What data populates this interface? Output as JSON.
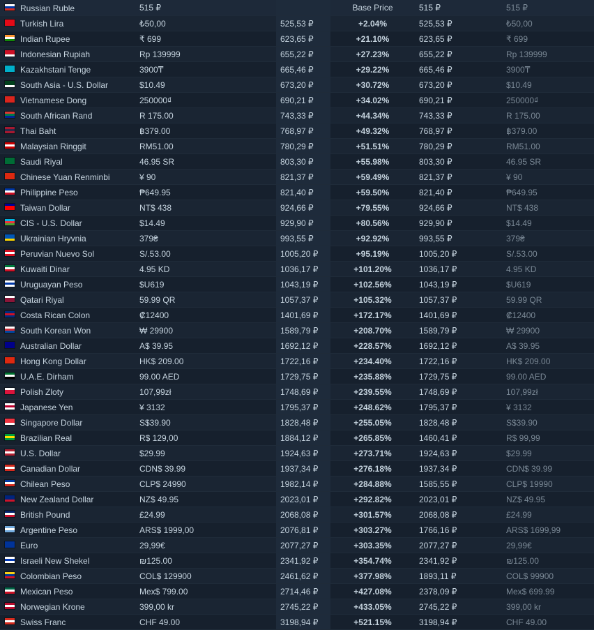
{
  "header": {
    "currency": "Russian Ruble",
    "local_price": "515 ₽",
    "base_price_label": "Base Price",
    "recommended": "515 ₽",
    "suggested": "515 ₽",
    "flag": [
      "#ffffff",
      "#0039a6",
      "#d52b1e"
    ]
  },
  "colors": {
    "increase": "#c94a4a",
    "decrease": "#9a8cf0",
    "text": "#c6d4df",
    "muted": "#7a8895"
  },
  "rows": [
    {
      "currency": "Turkish Lira",
      "local_price": "₺50,00",
      "base_price": "525,53 ₽",
      "diff": "+2.04%",
      "recommended": "525,53 ₽",
      "suggested": "₺50,00",
      "flag": [
        "#e30a17",
        "#e30a17",
        "#e30a17"
      ]
    },
    {
      "currency": "Indian Rupee",
      "local_price": "₹ 699",
      "base_price": "623,65 ₽",
      "diff": "+21.10%",
      "recommended": "623,65 ₽",
      "suggested": "₹ 699",
      "flag": [
        "#ff9933",
        "#ffffff",
        "#138808"
      ]
    },
    {
      "currency": "Indonesian Rupiah",
      "local_price": "Rp 139999",
      "base_price": "655,22 ₽",
      "diff": "+27.23%",
      "recommended": "655,22 ₽",
      "suggested": "Rp 139999",
      "flag": [
        "#ce1126",
        "#ce1126",
        "#ffffff"
      ]
    },
    {
      "currency": "Kazakhstani Tenge",
      "local_price": "3900₸",
      "base_price": "665,46 ₽",
      "diff": "+29.22%",
      "recommended": "665,46 ₽",
      "suggested": "3900₸",
      "flag": [
        "#00afca",
        "#00afca",
        "#00afca"
      ]
    },
    {
      "currency": "South Asia - U.S. Dollar",
      "local_price": "$10.49",
      "base_price": "673,20 ₽",
      "diff": "+30.72%",
      "recommended": "673,20 ₽",
      "suggested": "$10.49",
      "flag": [
        "#01411c",
        "#01411c",
        "#ffffff"
      ]
    },
    {
      "currency": "Vietnamese Dong",
      "local_price": "250000₫",
      "base_price": "690,21 ₽",
      "diff": "+34.02%",
      "recommended": "690,21 ₽",
      "suggested": "250000₫",
      "flag": [
        "#da251d",
        "#da251d",
        "#da251d"
      ]
    },
    {
      "currency": "South African Rand",
      "local_price": "R 175.00",
      "base_price": "743,33 ₽",
      "diff": "+44.34%",
      "recommended": "743,33 ₽",
      "suggested": "R 175.00",
      "flag": [
        "#de3831",
        "#007a4d",
        "#002395"
      ]
    },
    {
      "currency": "Thai Baht",
      "local_price": "฿379.00",
      "base_price": "768,97 ₽",
      "diff": "+49.32%",
      "recommended": "768,97 ₽",
      "suggested": "฿379.00",
      "flag": [
        "#a51931",
        "#2d2a4a",
        "#a51931"
      ]
    },
    {
      "currency": "Malaysian Ringgit",
      "local_price": "RM51.00",
      "base_price": "780,29 ₽",
      "diff": "+51.51%",
      "recommended": "780,29 ₽",
      "suggested": "RM51.00",
      "flag": [
        "#cc0001",
        "#ffffff",
        "#cc0001"
      ]
    },
    {
      "currency": "Saudi Riyal",
      "local_price": "46.95 SR",
      "base_price": "803,30 ₽",
      "diff": "+55.98%",
      "recommended": "803,30 ₽",
      "suggested": "46.95 SR",
      "flag": [
        "#006c35",
        "#006c35",
        "#006c35"
      ]
    },
    {
      "currency": "Chinese Yuan Renminbi",
      "local_price": "¥ 90",
      "base_price": "821,37 ₽",
      "diff": "+59.49%",
      "recommended": "821,37 ₽",
      "suggested": "¥ 90",
      "flag": [
        "#de2910",
        "#de2910",
        "#de2910"
      ]
    },
    {
      "currency": "Philippine Peso",
      "local_price": "₱649.95",
      "base_price": "821,40 ₽",
      "diff": "+59.50%",
      "recommended": "821,40 ₽",
      "suggested": "₱649.95",
      "flag": [
        "#0038a8",
        "#ffffff",
        "#ce1126"
      ]
    },
    {
      "currency": "Taiwan Dollar",
      "local_price": "NT$ 438",
      "base_price": "924,66 ₽",
      "diff": "+79.55%",
      "recommended": "924,66 ₽",
      "suggested": "NT$ 438",
      "flag": [
        "#000095",
        "#fe0000",
        "#fe0000"
      ]
    },
    {
      "currency": "CIS - U.S. Dollar",
      "local_price": "$14.49",
      "base_price": "929,90 ₽",
      "diff": "+80.56%",
      "recommended": "929,90 ₽",
      "suggested": "$14.49",
      "flag": [
        "#00b5e2",
        "#ef3340",
        "#509e2f"
      ]
    },
    {
      "currency": "Ukrainian Hryvnia",
      "local_price": "379₴",
      "base_price": "993,55 ₽",
      "diff": "+92.92%",
      "recommended": "993,55 ₽",
      "suggested": "379₴",
      "flag": [
        "#0057b7",
        "#0057b7",
        "#ffd700"
      ]
    },
    {
      "currency": "Peruvian Nuevo Sol",
      "local_price": "S/.53.00",
      "base_price": "1005,20 ₽",
      "diff": "+95.19%",
      "recommended": "1005,20 ₽",
      "suggested": "S/.53.00",
      "flag": [
        "#d91023",
        "#ffffff",
        "#d91023"
      ]
    },
    {
      "currency": "Kuwaiti Dinar",
      "local_price": "4.95 KD",
      "base_price": "1036,17 ₽",
      "diff": "+101.20%",
      "recommended": "1036,17 ₽",
      "suggested": "4.95 KD",
      "flag": [
        "#007a3d",
        "#ffffff",
        "#ce1126"
      ]
    },
    {
      "currency": "Uruguayan Peso",
      "local_price": "$U619",
      "base_price": "1043,19 ₽",
      "diff": "+102.56%",
      "recommended": "1043,19 ₽",
      "suggested": "$U619",
      "flag": [
        "#ffffff",
        "#0038a8",
        "#ffffff"
      ]
    },
    {
      "currency": "Qatari Riyal",
      "local_price": "59.99 QR",
      "base_price": "1057,37 ₽",
      "diff": "+105.32%",
      "recommended": "1057,37 ₽",
      "suggested": "59.99 QR",
      "flag": [
        "#ffffff",
        "#8a1538",
        "#8a1538"
      ]
    },
    {
      "currency": "Costa Rican Colon",
      "local_price": "₡12400",
      "base_price": "1401,69 ₽",
      "diff": "+172.17%",
      "recommended": "1401,69 ₽",
      "suggested": "₡12400",
      "flag": [
        "#002b7f",
        "#ce1126",
        "#002b7f"
      ]
    },
    {
      "currency": "South Korean Won",
      "local_price": "₩ 29900",
      "base_price": "1589,79 ₽",
      "diff": "+208.70%",
      "recommended": "1589,79 ₽",
      "suggested": "₩ 29900",
      "flag": [
        "#ffffff",
        "#cd2e3a",
        "#0047a0"
      ]
    },
    {
      "currency": "Australian Dollar",
      "local_price": "A$ 39.95",
      "base_price": "1692,12 ₽",
      "diff": "+228.57%",
      "recommended": "1692,12 ₽",
      "suggested": "A$ 39.95",
      "flag": [
        "#00008b",
        "#00008b",
        "#00008b"
      ]
    },
    {
      "currency": "Hong Kong Dollar",
      "local_price": "HK$ 209.00",
      "base_price": "1722,16 ₽",
      "diff": "+234.40%",
      "recommended": "1722,16 ₽",
      "suggested": "HK$ 209.00",
      "flag": [
        "#de2910",
        "#de2910",
        "#de2910"
      ]
    },
    {
      "currency": "U.A.E. Dirham",
      "local_price": "99.00 AED",
      "base_price": "1729,75 ₽",
      "diff": "+235.88%",
      "recommended": "1729,75 ₽",
      "suggested": "99.00 AED",
      "flag": [
        "#00732f",
        "#ffffff",
        "#000000"
      ]
    },
    {
      "currency": "Polish Zloty",
      "local_price": "107,99zł",
      "base_price": "1748,69 ₽",
      "diff": "+239.55%",
      "recommended": "1748,69 ₽",
      "suggested": "107,99zł",
      "flag": [
        "#ffffff",
        "#dc143c",
        "#dc143c"
      ]
    },
    {
      "currency": "Japanese Yen",
      "local_price": "¥ 3132",
      "base_price": "1795,37 ₽",
      "diff": "+248.62%",
      "recommended": "1795,37 ₽",
      "suggested": "¥ 3132",
      "flag": [
        "#ffffff",
        "#bc002d",
        "#ffffff"
      ]
    },
    {
      "currency": "Singapore Dollar",
      "local_price": "S$39.90",
      "base_price": "1828,48 ₽",
      "diff": "+255.05%",
      "recommended": "1828,48 ₽",
      "suggested": "S$39.90",
      "flag": [
        "#ef3340",
        "#ef3340",
        "#ffffff"
      ]
    },
    {
      "currency": "Brazilian Real",
      "local_price": "R$ 129,00",
      "base_price": "1884,12 ₽",
      "diff": "+265.85%",
      "recommended": "1460,41 ₽",
      "suggested": "R$ 99,99",
      "flag": [
        "#009c3b",
        "#ffdf00",
        "#009c3b"
      ]
    },
    {
      "currency": "U.S. Dollar",
      "local_price": "$29.99",
      "base_price": "1924,63 ₽",
      "diff": "+273.71%",
      "recommended": "1924,63 ₽",
      "suggested": "$29.99",
      "flag": [
        "#b22234",
        "#ffffff",
        "#b22234"
      ]
    },
    {
      "currency": "Canadian Dollar",
      "local_price": "CDN$ 39.99",
      "base_price": "1937,34 ₽",
      "diff": "+276.18%",
      "recommended": "1937,34 ₽",
      "suggested": "CDN$ 39.99",
      "flag": [
        "#d52b1e",
        "#ffffff",
        "#d52b1e"
      ]
    },
    {
      "currency": "Chilean Peso",
      "local_price": "CLP$ 24990",
      "base_price": "1982,14 ₽",
      "diff": "+284.88%",
      "recommended": "1585,55 ₽",
      "suggested": "CLP$ 19990",
      "flag": [
        "#0039a6",
        "#ffffff",
        "#d52b1e"
      ]
    },
    {
      "currency": "New Zealand Dollar",
      "local_price": "NZ$ 49.95",
      "base_price": "2023,01 ₽",
      "diff": "+292.82%",
      "recommended": "2023,01 ₽",
      "suggested": "NZ$ 49.95",
      "flag": [
        "#00247d",
        "#00247d",
        "#cc142b"
      ]
    },
    {
      "currency": "British Pound",
      "local_price": "£24.99",
      "base_price": "2068,08 ₽",
      "diff": "+301.57%",
      "recommended": "2068,08 ₽",
      "suggested": "£24.99",
      "flag": [
        "#012169",
        "#ffffff",
        "#c8102e"
      ]
    },
    {
      "currency": "Argentine Peso",
      "local_price": "ARS$ 1999,00",
      "base_price": "2076,81 ₽",
      "diff": "+303.27%",
      "recommended": "1766,16 ₽",
      "suggested": "ARS$ 1699,99",
      "flag": [
        "#74acdf",
        "#ffffff",
        "#74acdf"
      ]
    },
    {
      "currency": "Euro",
      "local_price": "29,99€",
      "base_price": "2077,27 ₽",
      "diff": "+303.35%",
      "recommended": "2077,27 ₽",
      "suggested": "29,99€",
      "flag": [
        "#003399",
        "#003399",
        "#003399"
      ]
    },
    {
      "currency": "Israeli New Shekel",
      "local_price": "₪125.00",
      "base_price": "2341,92 ₽",
      "diff": "+354.74%",
      "recommended": "2341,92 ₽",
      "suggested": "₪125.00",
      "flag": [
        "#ffffff",
        "#0038b8",
        "#ffffff"
      ]
    },
    {
      "currency": "Colombian Peso",
      "local_price": "COL$ 129900",
      "base_price": "2461,62 ₽",
      "diff": "+377.98%",
      "recommended": "1893,11 ₽",
      "suggested": "COL$ 99900",
      "flag": [
        "#fcd116",
        "#003893",
        "#ce1126"
      ]
    },
    {
      "currency": "Mexican Peso",
      "local_price": "Mex$ 799.00",
      "base_price": "2714,46 ₽",
      "diff": "+427.08%",
      "recommended": "2378,09 ₽",
      "suggested": "Mex$ 699.99",
      "flag": [
        "#006847",
        "#ffffff",
        "#ce1126"
      ]
    },
    {
      "currency": "Norwegian Krone",
      "local_price": "399,00 kr",
      "base_price": "2745,22 ₽",
      "diff": "+433.05%",
      "recommended": "2745,22 ₽",
      "suggested": "399,00 kr",
      "flag": [
        "#ba0c2f",
        "#ffffff",
        "#ba0c2f"
      ]
    },
    {
      "currency": "Swiss Franc",
      "local_price": "CHF 49.00",
      "base_price": "3198,94 ₽",
      "diff": "+521.15%",
      "recommended": "3198,94 ₽",
      "suggested": "CHF 49.00",
      "flag": [
        "#d52b1e",
        "#ffffff",
        "#d52b1e"
      ]
    }
  ]
}
